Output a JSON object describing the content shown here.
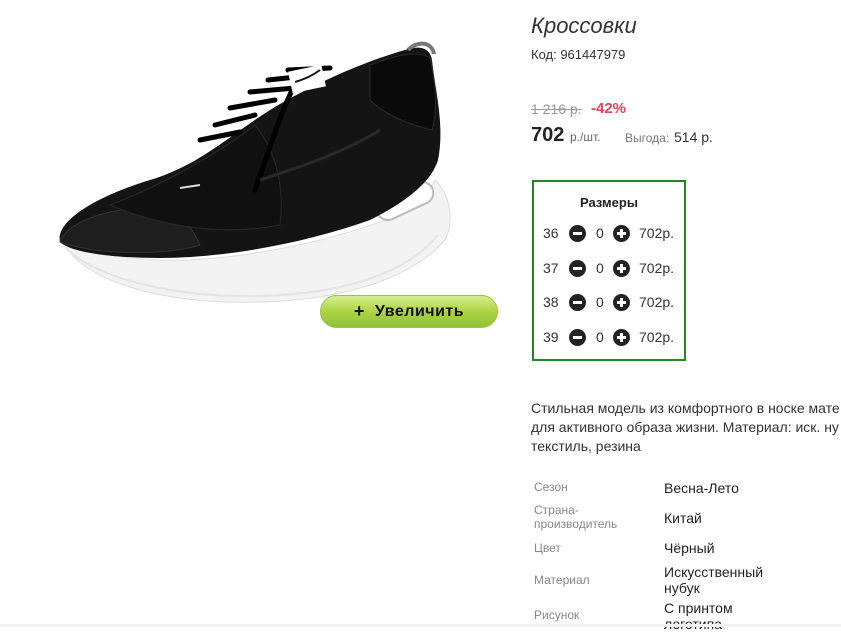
{
  "product": {
    "title": "Кроссовки",
    "code": "Код: 961447979",
    "old_price": "1 216 р.",
    "discount": "-42%",
    "price": "702",
    "unit": "р./шт.",
    "benefit_label": "Выгода:",
    "benefit_value": "514 р."
  },
  "zoom": {
    "plus": "+",
    "label": "Увеличить"
  },
  "sizes": {
    "title": "Размеры",
    "rows": [
      {
        "size": "36",
        "qty": "0",
        "price": "702р."
      },
      {
        "size": "37",
        "qty": "0",
        "price": "702р."
      },
      {
        "size": "38",
        "qty": "0",
        "price": "702р."
      },
      {
        "size": "39",
        "qty": "0",
        "price": "702р."
      }
    ]
  },
  "description": [
    "Стильная модель из комфортного в носке мате",
    "для активного образа жизни. Материал: иск. ну",
    "текстиль, резина"
  ],
  "attributes": [
    {
      "label": "Сезон",
      "value": "Весна-Лето"
    },
    {
      "label": "Страна-производитель",
      "value": "Китай"
    },
    {
      "label": "Цвет",
      "value": "Чёрный"
    },
    {
      "label": "Материал",
      "value": "Искусственный нубук"
    },
    {
      "label": "Рисунок",
      "value": "С принтом логотипа"
    }
  ],
  "colors": {
    "accent_green": "#1f8a1f",
    "discount_red": "#e8415a",
    "button_green": "#a9d142"
  }
}
